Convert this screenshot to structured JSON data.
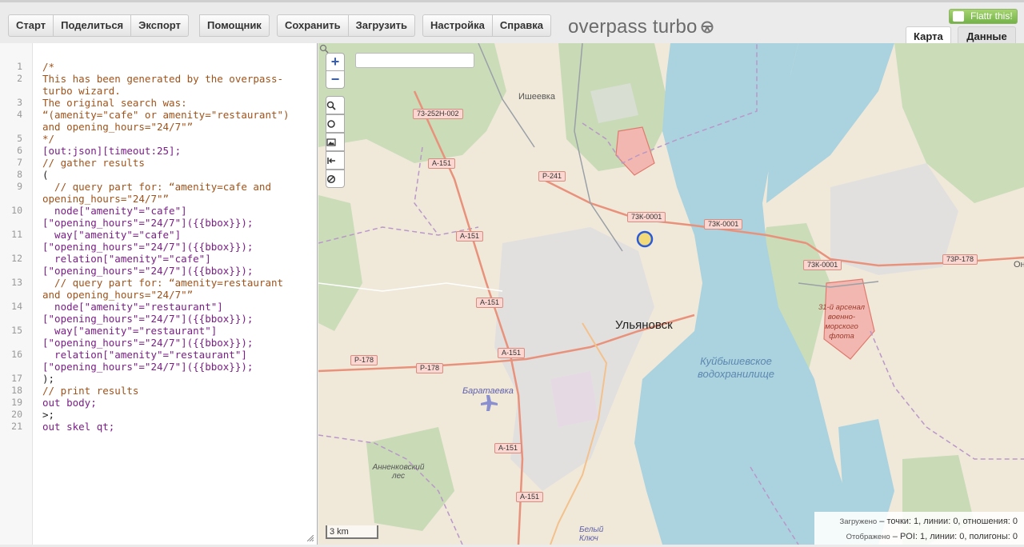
{
  "toolbar": {
    "groups": [
      [
        "Старт",
        "Поделиться",
        "Экспорт"
      ],
      [
        "Помощник"
      ],
      [
        "Сохранить",
        "Загрузить"
      ],
      [
        "Настройка",
        "Справка"
      ]
    ]
  },
  "logo": {
    "text": "overpass turbo",
    "icon": "steering-wheel-icon"
  },
  "flattr": {
    "label": "Flattr this!"
  },
  "tabs": {
    "map": "Карта",
    "data": "Данные"
  },
  "editor": {
    "line_numbers": [
      "1",
      "2",
      "3",
      "4",
      "5",
      "6",
      "7",
      "8",
      "9",
      "10",
      "11",
      "12",
      "13",
      "14",
      "15",
      "16",
      "17",
      "18",
      "19",
      "20",
      "21"
    ],
    "lines": [
      "/*",
      "This has been generated by the overpass-",
      "turbo wizard.",
      "The original search was:",
      "“(amenity=\"cafe\" or amenity=\"restaurant\")",
      "and opening_hours=\"24/7\"”",
      "*/",
      "[out:json][timeout:25];",
      "// gather results",
      "(",
      "  // query part for: “amenity=cafe and",
      "opening_hours=\"24/7\"”",
      "  node[\"amenity\"=\"cafe\"]",
      "[\"opening_hours\"=\"24/7\"]({{bbox}});",
      "  way[\"amenity\"=\"cafe\"]",
      "[\"opening_hours\"=\"24/7\"]({{bbox}});",
      "  relation[\"amenity\"=\"cafe\"]",
      "[\"opening_hours\"=\"24/7\"]({{bbox}});",
      "  // query part for: “amenity=restaurant",
      "and opening_hours=\"24/7\"”",
      "  node[\"amenity\"=\"restaurant\"]",
      "[\"opening_hours\"=\"24/7\"]({{bbox}});",
      "  way[\"amenity\"=\"restaurant\"]",
      "[\"opening_hours\"=\"24/7\"]({{bbox}});",
      "  relation[\"amenity\"=\"restaurant\"]",
      "[\"opening_hours\"=\"24/7\"]({{bbox}});",
      ");",
      "// print results",
      "out body;",
      ">;",
      "out skel qt;"
    ]
  },
  "map": {
    "zoom_in": "+",
    "zoom_out": "−",
    "scale": "3 km",
    "city": "Ульяновск",
    "labels": {
      "isheevka": "Ишеевка",
      "reservoir": "Куйбышевское водохранилище",
      "baratayevka": "Баратаевка",
      "annenkovsky": "Анненковский лес",
      "arsenal": "31-й арсенал военно-морского флота",
      "bely_klyuch": "Белый Ключ",
      "edge_on": "Он"
    },
    "roads": {
      "r1": "73-252Н-002",
      "r2": "А-151",
      "r3": "Р-241",
      "r4": "73К-0001",
      "r5": "73К-0001",
      "r6": "А-151",
      "r7": "73К-0001",
      "r8": "73Р-178",
      "r9": "А-151",
      "r10": "А-151",
      "r11": "Р-178",
      "r12": "Р-178",
      "r13": "А-151",
      "r14": "А-151"
    },
    "status": {
      "loaded_label": "Загружено",
      "loaded_value": "– точки: 1, линии: 0, отношения: 0",
      "shown_label": "Отображено",
      "shown_value": "– POI: 1, линии: 0, полигоны: 0"
    },
    "colors": {
      "water": "#aad3df",
      "land": "#f0e9da",
      "forest": "#add19e",
      "urban": "#e0dfdf",
      "road": "#e8927c",
      "boundary": "#b998c8",
      "poi_marker": "#2a5bd7"
    }
  }
}
